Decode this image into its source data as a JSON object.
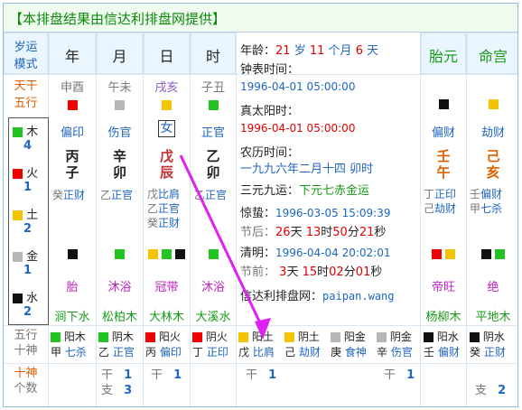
{
  "banner": "【本排盘结果由信达利排盘网提供】",
  "columns": {
    "mode": [
      "岁运",
      "模式"
    ],
    "year": "年",
    "month": "月",
    "day": "日",
    "hour": "时",
    "taiyuan": "胎元",
    "minggong": "命宫"
  },
  "row_labels": {
    "tiangan": "天干",
    "wuxing": "五行",
    "shishen_a": "五行",
    "shishen_b": "十神",
    "count_a": "十神",
    "count_b": "个数"
  },
  "ganzhi_wuxing": {
    "year": "申酉",
    "month": "午未",
    "day": "戌亥",
    "hour": "子丑"
  },
  "shishen_top": {
    "year": "偏印",
    "month": "伤官",
    "day": "女",
    "hour": "正官",
    "taiyuan": "偏财",
    "minggong": "劫财"
  },
  "pillars": {
    "year": [
      "丙",
      "子"
    ],
    "month": [
      "辛",
      "卯"
    ],
    "day": [
      "戊",
      "辰"
    ],
    "hour": [
      "乙",
      "卯"
    ],
    "taiyuan": [
      "壬",
      "午"
    ],
    "minggong": [
      "己",
      "亥"
    ]
  },
  "hidden": {
    "year": [
      {
        "gan": "癸",
        "god": "正财"
      }
    ],
    "month": [
      {
        "gan": "乙",
        "god": "正官"
      }
    ],
    "day": [
      {
        "gan": "戊",
        "god": "比肩"
      },
      {
        "gan": "乙",
        "god": "正官"
      },
      {
        "gan": "癸",
        "god": "正财"
      }
    ],
    "hour": [
      {
        "gan": "乙",
        "god": "正官"
      }
    ],
    "taiyuan": [
      {
        "gan": "丁",
        "god": "正印"
      },
      {
        "gan": "己",
        "god": "劫财"
      }
    ],
    "minggong": [
      {
        "gan": "壬",
        "god": "偏财"
      },
      {
        "gan": "甲",
        "god": "七杀"
      }
    ]
  },
  "wuxing_panel": [
    {
      "name": "木",
      "count": "4",
      "color": "green"
    },
    {
      "name": "火",
      "count": "1",
      "color": "red"
    },
    {
      "name": "土",
      "count": "2",
      "color": "yellow"
    },
    {
      "name": "金",
      "count": "1",
      "color": "gray"
    },
    {
      "name": "水",
      "count": "2",
      "color": "black"
    }
  ],
  "changsheng": {
    "year": "胎",
    "month": "沐浴",
    "day": "冠带",
    "hour": "沐浴",
    "taiyuan": "帝旺",
    "minggong": "绝"
  },
  "nayin": {
    "year": "涧下水",
    "month": "松柏木",
    "day": "大林木",
    "hour": "大溪水",
    "taiyuan": "杨柳木",
    "minggong": "平地木"
  },
  "info": {
    "age_label": "年龄：",
    "age_years": "21",
    "sui": "岁",
    "months": "11",
    "month_unit": "个月",
    "days": "6",
    "day_unit": "天",
    "clock_label": "钟表时间：",
    "clock_value": "1996-04-01 05:00:00",
    "solar_label": "真太阳时：",
    "solar_value": "1996-04-01 05:00:00",
    "lunar_label": "农历时间：",
    "lunar_value": "一九九六年二月十四 卯时",
    "sanyuan_label": "三元九运：",
    "sanyuan_value": "下元七赤金运",
    "jingzhe_label": "惊蛰：",
    "jingzhe_value": "1996-03-05 15:09:39",
    "after_label": "节后：",
    "after_d": "26",
    "after_d_u": "天",
    "after_h": "13",
    "after_h_u": "时",
    "after_m": "50",
    "after_m_u": "分",
    "after_s": "21",
    "after_s_u": "秒",
    "qingming_label": "清明：",
    "qingming_value": "1996-04-04 20:02:01",
    "before_label": "节前：",
    "before_d": "3",
    "before_d_u": "天",
    "before_h": "15",
    "before_h_u": "时",
    "before_m": "02",
    "before_m_u": "分",
    "before_s": "01",
    "before_s_u": "秒",
    "site_label": "信达利排盘网：",
    "site_value": "paipan.wang"
  },
  "bottom_wx": [
    {
      "sq": "green",
      "yy": "阳木",
      "gan": "甲",
      "god": "七杀"
    },
    {
      "sq": "green",
      "yy": "阴木",
      "gan": "乙",
      "god": "正官"
    },
    {
      "sq": "red",
      "yy": "阳火",
      "gan": "丙",
      "god": "偏印"
    },
    {
      "sq": "red",
      "yy": "阴火",
      "gan": "丁",
      "god": "正印"
    },
    {
      "sq": "yellow",
      "yy": "阳土",
      "gan": "戊",
      "god": "比肩"
    },
    {
      "sq": "yellow",
      "yy": "阴土",
      "gan": "己",
      "god": "劫财"
    },
    {
      "sq": "gray",
      "yy": "阳金",
      "gan": "庚",
      "god": "食神"
    },
    {
      "sq": "gray",
      "yy": "阴金",
      "gan": "辛",
      "god": "伤官"
    },
    {
      "sq": "black",
      "yy": "阳水",
      "gan": "壬",
      "god": "偏财"
    },
    {
      "sq": "black",
      "yy": "阴水",
      "gan": "癸",
      "god": "正财"
    }
  ],
  "bottom_counts": [
    {
      "a": "干",
      "av": "1",
      "b": "支",
      "bv": "3"
    },
    {
      "a": "干",
      "av": "1",
      "b": "",
      "bv": ""
    },
    {
      "a": "干",
      "av": "1",
      "b": "",
      "bv": ""
    },
    {
      "a": "干",
      "av": "1",
      "b": "支",
      "bv": "2"
    }
  ]
}
